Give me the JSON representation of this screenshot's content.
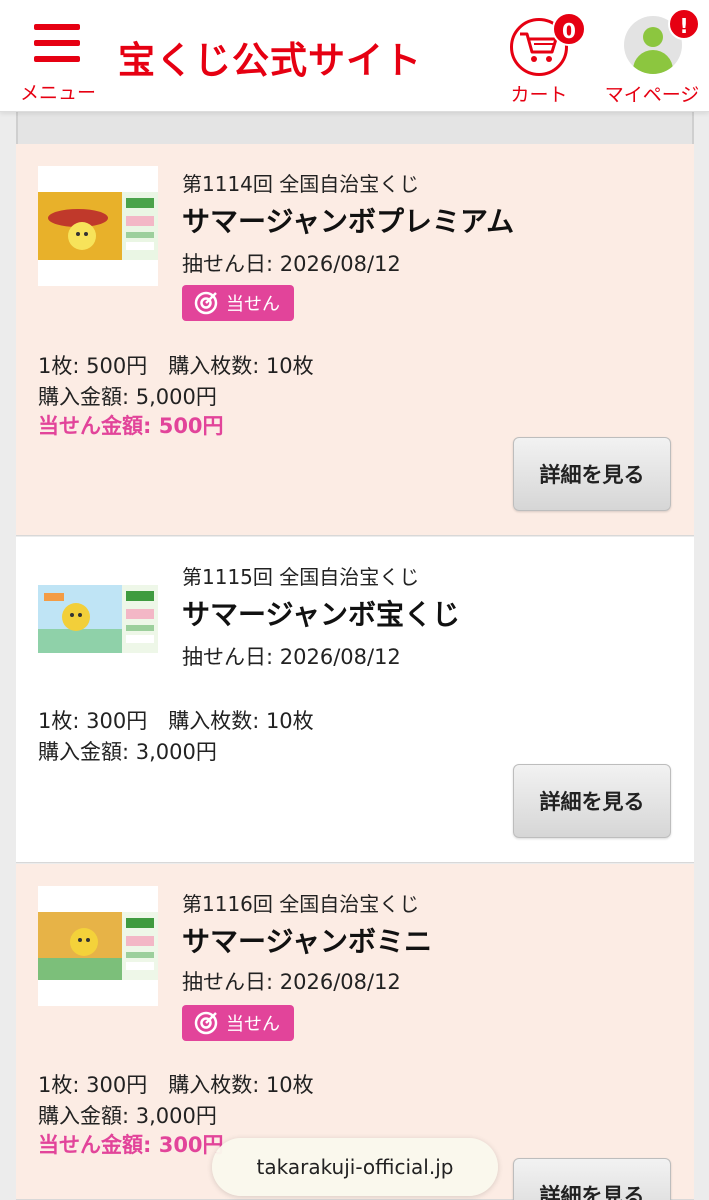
{
  "header": {
    "menu_label": "メニュー",
    "site_title": "宝くじ公式サイト",
    "cart_label": "カート",
    "cart_count": "0",
    "mypage_label": "マイページ",
    "mypage_alert": "!"
  },
  "colors": {
    "brand_red": "#e60012",
    "win_pink": "#e2449a",
    "won_card_bg": "#fcece4",
    "avatar_green": "#8cc63f"
  },
  "lots": [
    {
      "round": "第1114回 全国自治宝くじ",
      "name": "サマージャンボプレミアム",
      "draw_date": "抽せん日: 2026/08/12",
      "win_badge": "当せん",
      "price_line": "1枚: 500円　購入枚数: 10枚",
      "amount_line": "購入金額: 5,000円",
      "prize_line": "当せん金額: 500円",
      "detail_button": "詳細を見る",
      "won": true
    },
    {
      "round": "第1115回 全国自治宝くじ",
      "name": "サマージャンボ宝くじ",
      "draw_date": "抽せん日: 2026/08/12",
      "price_line": "1枚: 300円　購入枚数: 10枚",
      "amount_line": "購入金額: 3,000円",
      "detail_button": "詳細を見る",
      "won": false
    },
    {
      "round": "第1116回 全国自治宝くじ",
      "name": "サマージャンボミニ",
      "draw_date": "抽せん日: 2026/08/12",
      "win_badge": "当せん",
      "price_line": "1枚: 300円　購入枚数: 10枚",
      "amount_line": "購入金額: 3,000円",
      "prize_line": "当せん金額: 300円",
      "detail_button": "詳細を見る",
      "won": true
    }
  ],
  "browser": {
    "url": "takarakuji-official.jp"
  }
}
